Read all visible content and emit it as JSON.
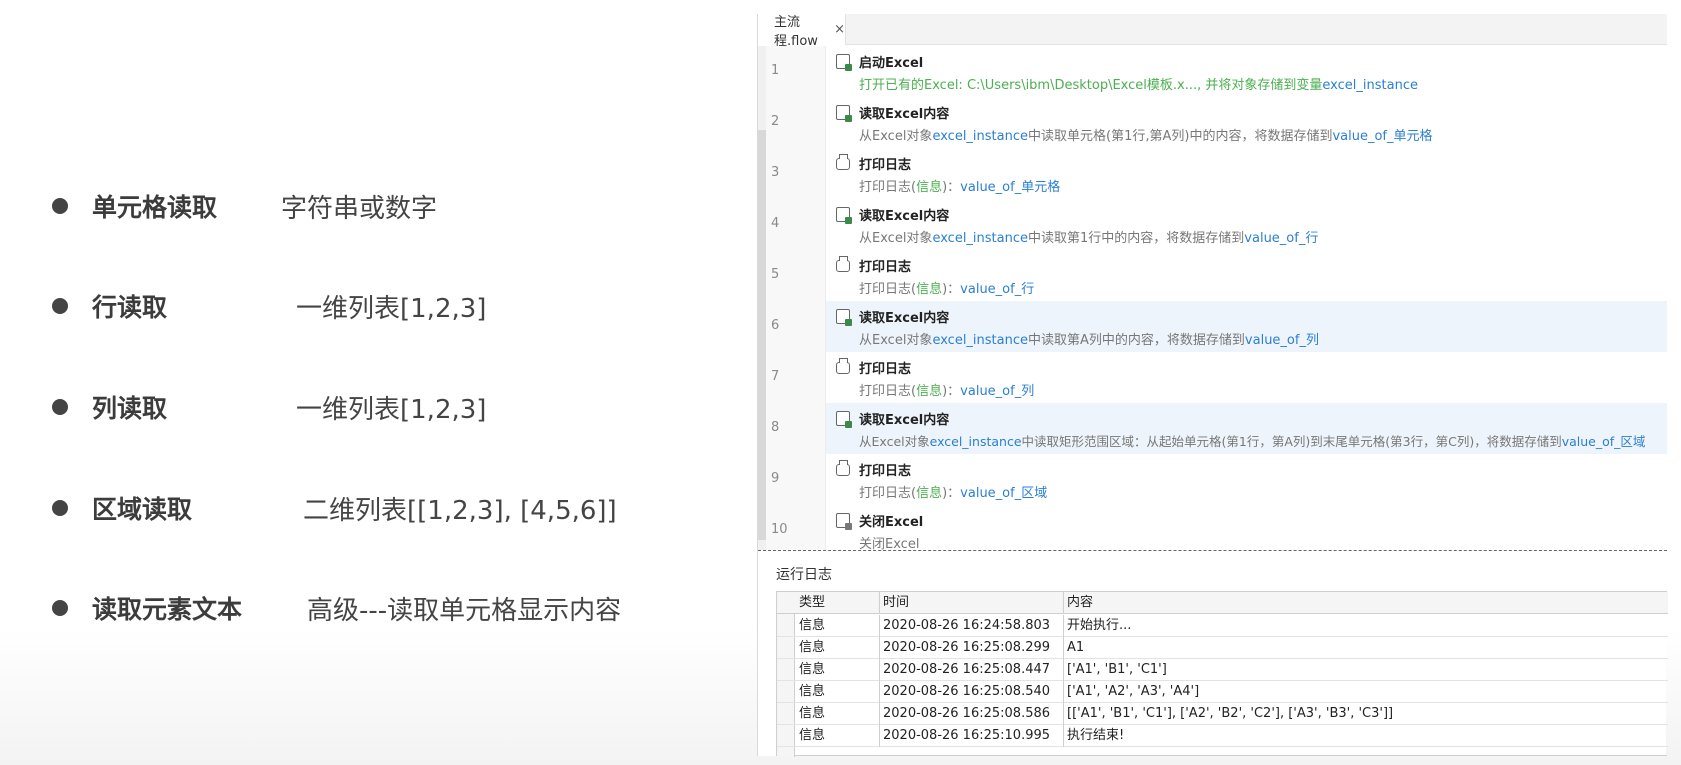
{
  "bullets": [
    {
      "title": "单元格读取",
      "desc": "字符串或数字"
    },
    {
      "title": "行读取",
      "desc": "一维列表[1,2,3]"
    },
    {
      "title": "列读取",
      "desc": "一维列表[1,2,3]"
    },
    {
      "title": "区域读取",
      "desc": "二维列表[[1,2,3], [4,5,6]]"
    },
    {
      "title": "读取元素文本",
      "desc": "高级---读取单元格显示内容"
    }
  ],
  "editor": {
    "tab": {
      "label": "主流程.flow",
      "close": "×"
    },
    "steps": [
      {
        "num": "1",
        "icon": "excel-launch-icon",
        "title": "启动Excel",
        "p1": "打开已有的Excel: C:\\Users\\ibm\\Desktop\\Excel模板.x..., 并将对象存储到变量",
        "p2": "excel_instance",
        "p3": "",
        "p4": "",
        "p5": ""
      },
      {
        "num": "2",
        "icon": "excel-read-icon",
        "title": "读取Excel内容",
        "p1": "从Excel对象",
        "p2": "excel_instance",
        "p3": "中读取单元格(第1行,第A列)中的内容，将数据存储到",
        "p4": "value_of_单元格",
        "p5": ""
      },
      {
        "num": "3",
        "icon": "print-icon",
        "title": "打印日志",
        "p1": "打印日志(",
        "p2": "信息",
        "p3": ")：",
        "p4": "value_of_单元格",
        "p5": ""
      },
      {
        "num": "4",
        "icon": "excel-read-icon",
        "title": "读取Excel内容",
        "p1": "从Excel对象",
        "p2": "excel_instance",
        "p3": "中读取第1行中的内容，将数据存储到",
        "p4": "value_of_行",
        "p5": ""
      },
      {
        "num": "5",
        "icon": "print-icon",
        "title": "打印日志",
        "p1": "打印日志(",
        "p2": "信息",
        "p3": ")：",
        "p4": "value_of_行",
        "p5": ""
      },
      {
        "num": "6",
        "icon": "excel-read-icon",
        "title": "读取Excel内容",
        "p1": "从Excel对象",
        "p2": "excel_instance",
        "p3": "中读取第A列中的内容，将数据存储到",
        "p4": "value_of_列",
        "p5": ""
      },
      {
        "num": "7",
        "icon": "print-icon",
        "title": "打印日志",
        "p1": "打印日志(",
        "p2": "信息",
        "p3": ")：",
        "p4": "value_of_列",
        "p5": ""
      },
      {
        "num": "8",
        "icon": "excel-read-icon",
        "title": "读取Excel内容",
        "p1": "从Excel对象",
        "p2": "excel_instance",
        "p3": "中读取矩形范围区域：从起始单元格(第1行，第A列)到末尾单元格(第3行，第C列)，将数据存储到",
        "p4": "value_of_区域",
        "p5": ""
      },
      {
        "num": "9",
        "icon": "print-icon",
        "title": "打印日志",
        "p1": "打印日志(",
        "p2": "信息",
        "p3": ")：",
        "p4": "value_of_区域",
        "p5": ""
      },
      {
        "num": "10",
        "icon": "excel-close-icon",
        "title": "关闭Excel",
        "p1": "关闭Excel",
        "p2": "",
        "p3": "",
        "p4": "",
        "p5": ""
      }
    ]
  },
  "log": {
    "title": "运行日志",
    "headers": {
      "type": "类型",
      "time": "时间",
      "content": "内容"
    },
    "rows": [
      {
        "type": "信息",
        "time": "2020-08-26 16:24:58.803",
        "content": "开始执行..."
      },
      {
        "type": "信息",
        "time": "2020-08-26 16:25:08.299",
        "content": "A1"
      },
      {
        "type": "信息",
        "time": "2020-08-26 16:25:08.447",
        "content": "['A1', 'B1', 'C1']"
      },
      {
        "type": "信息",
        "time": "2020-08-26 16:25:08.540",
        "content": "['A1', 'A2', 'A3', 'A4']"
      },
      {
        "type": "信息",
        "time": "2020-08-26 16:25:08.586",
        "content": "[['A1', 'B1', 'C1'], ['A2', 'B2', 'C2'], ['A3', 'B3', 'C3']]"
      },
      {
        "type": "信息",
        "time": "2020-08-26 16:25:10.995",
        "content": "执行结束!"
      }
    ]
  },
  "colors": {
    "accent_blue": "#2a7fd4",
    "accent_green": "#4caf50",
    "highlight_row": "#eef4fb"
  }
}
